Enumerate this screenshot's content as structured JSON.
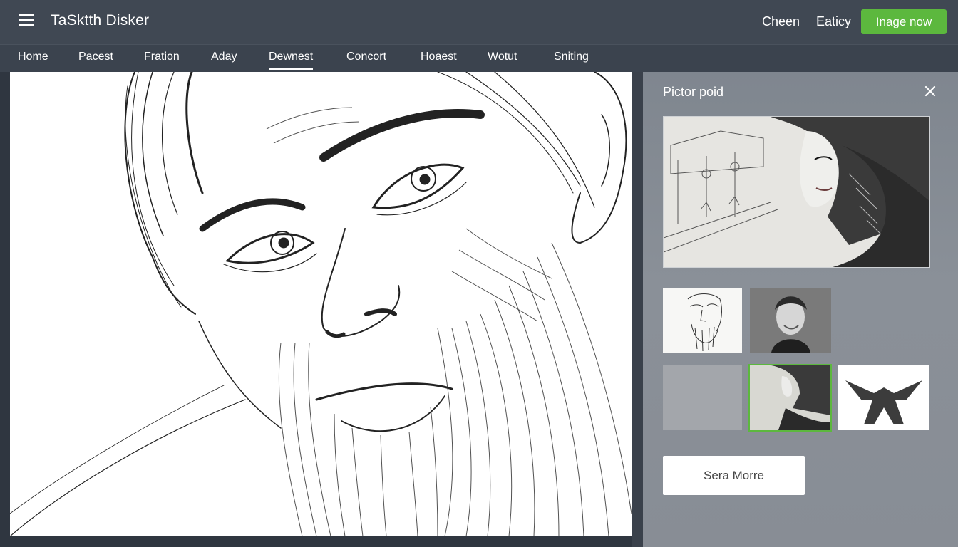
{
  "app": {
    "title": "TaSktth Disker"
  },
  "header": {
    "links": [
      "Cheen",
      "Eaticy"
    ],
    "cta_label": "Inage now",
    "accent": "#5cb83e"
  },
  "nav": {
    "items": [
      "Home",
      "Pacest",
      "Fration",
      "Aday",
      "Dewnest",
      "Concort",
      "Hoaest",
      "Wotut",
      "Sniting"
    ],
    "active": "Dewnest"
  },
  "panel": {
    "title": "Pictor poid",
    "more_label": "Sera Morre",
    "selected_thumb": 4
  },
  "icons": [
    "menu-icon",
    "close-icon"
  ]
}
